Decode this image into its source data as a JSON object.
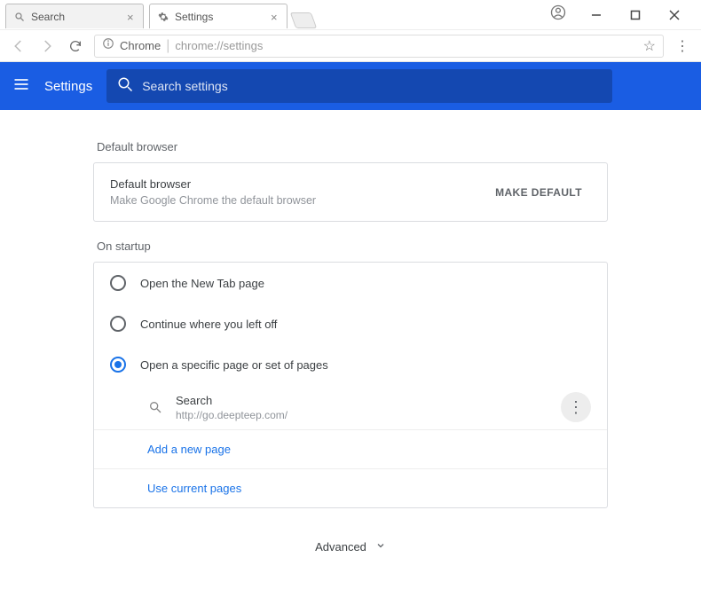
{
  "tabs": [
    {
      "title": "Search"
    },
    {
      "title": "Settings"
    }
  ],
  "address": {
    "app": "Chrome",
    "url": "chrome://settings"
  },
  "header": {
    "title": "Settings",
    "search_placeholder": "Search settings"
  },
  "sections": {
    "default_browser_label": "Default browser",
    "default_browser_card": {
      "title": "Default browser",
      "subtitle": "Make Google Chrome the default browser",
      "button": "MAKE DEFAULT"
    },
    "on_startup_label": "On startup",
    "startup_options": [
      "Open the New Tab page",
      "Continue where you left off",
      "Open a specific page or set of pages"
    ],
    "startup_page": {
      "title": "Search",
      "url": "http://go.deepteep.com/"
    },
    "add_page": "Add a new page",
    "use_current": "Use current pages",
    "advanced": "Advanced"
  }
}
